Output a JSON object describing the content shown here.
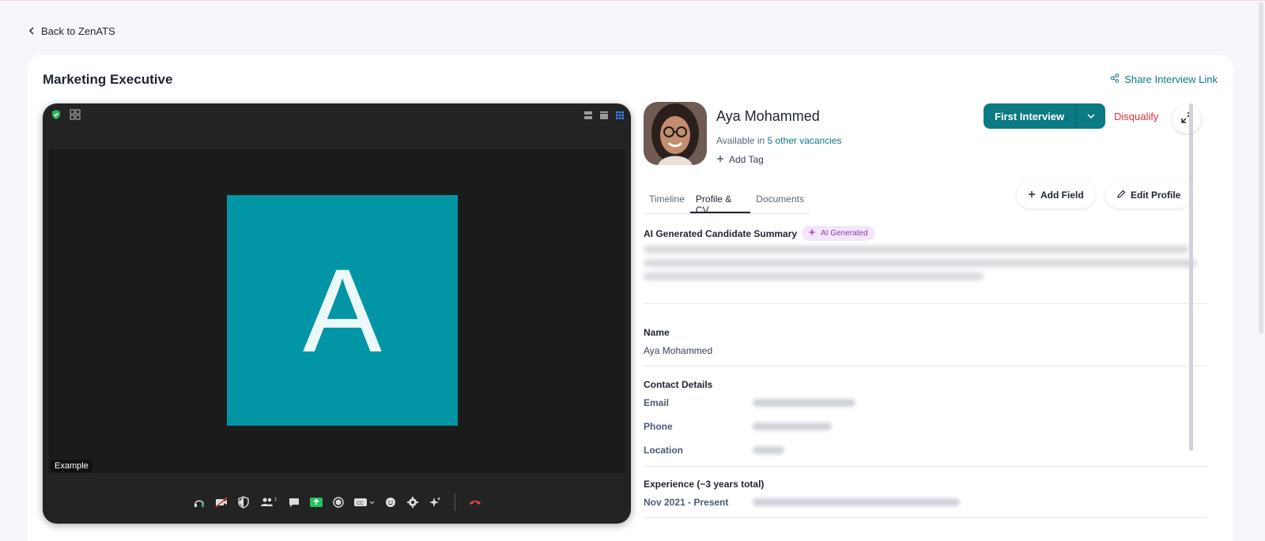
{
  "nav": {
    "back_label": "Back to ZenATS"
  },
  "header": {
    "title": "Marketing Executive",
    "share_label": "Share Interview Link"
  },
  "video": {
    "participant_initial": "A",
    "participant_label": "Example",
    "controls": [
      "headphones-icon",
      "camera-off-icon",
      "shield-icon",
      "participants-icon",
      "chat-icon",
      "share-screen-icon",
      "record-icon",
      "captions-icon",
      "reactions-icon",
      "settings-icon",
      "ai-sparkle-icon",
      "end-call-icon"
    ],
    "participants_count": "1"
  },
  "candidate": {
    "name": "Aya Mohammed",
    "available_prefix": "Available in",
    "available_link": "5 other vacancies",
    "add_tag": "Add Tag",
    "stage_button": "First Interview",
    "disqualify": "Disqualify"
  },
  "tabs": [
    "Timeline",
    "Profile & CV",
    "Documents"
  ],
  "active_tab": "Profile & CV",
  "actions": {
    "add_field": "Add Field",
    "edit_profile": "Edit Profile"
  },
  "summary": {
    "title": "AI Generated Candidate Summary",
    "badge": "AI Generated"
  },
  "profile": {
    "name_label": "Name",
    "name_value": "Aya Mohammed",
    "contact_label": "Contact Details",
    "email_label": "Email",
    "phone_label": "Phone",
    "location_label": "Location",
    "experience_label": "Experience (~3 years total)",
    "experience_date": "Nov 2021 - Present"
  },
  "colors": {
    "accent": "#0b7a82",
    "danger": "#e02d45",
    "tile": "#0195a6"
  }
}
